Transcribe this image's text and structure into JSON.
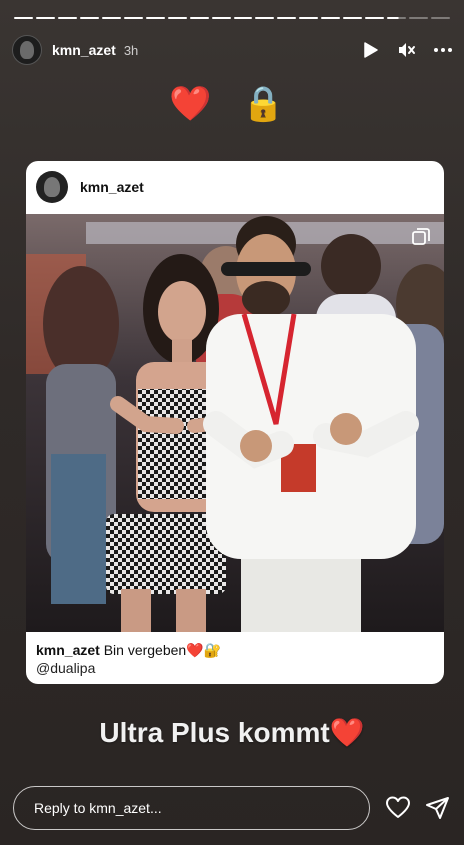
{
  "progress": {
    "segments": 20,
    "completed": 17,
    "current_fraction": 0.6
  },
  "header": {
    "username": "kmn_azet",
    "time": "3h"
  },
  "emojis": "❤️ 🔒",
  "card": {
    "username": "kmn_azet",
    "caption_user": "kmn_azet",
    "caption_text": "Bin vergeben❤️🔐",
    "mention": "@dualipa"
  },
  "caption": "Ultra Plus kommt❤️",
  "reply": {
    "placeholder": "Reply to kmn_azet..."
  },
  "colors": {
    "background": "#2f2a28",
    "card": "#ffffff",
    "text": "#ffffff"
  },
  "icons": [
    "play-icon",
    "mute-icon",
    "more-icon",
    "heart-icon",
    "send-icon",
    "multi-photo-icon"
  ]
}
